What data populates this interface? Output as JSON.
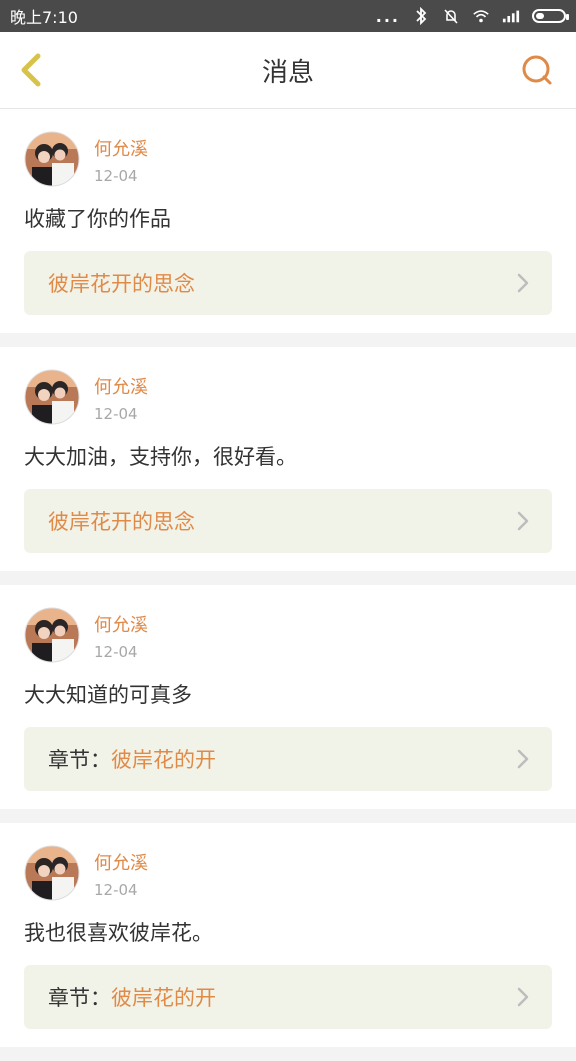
{
  "status": {
    "time": "晚上7:10",
    "dots": "...",
    "icons": [
      "bluetooth-icon",
      "mute-bell-icon",
      "wifi-icon",
      "signal-icon",
      "battery-icon"
    ]
  },
  "header": {
    "title": "消息",
    "back_icon": "chevron-left-icon",
    "search_icon": "search-icon"
  },
  "colors": {
    "accent": "#e08a48",
    "back": "#d8c34a",
    "card_link_bg": "#f2f3e8"
  },
  "messages": [
    {
      "username": "何允溪",
      "date": "12-04",
      "text": "收藏了你的作品",
      "prefix": "",
      "work": "彼岸花开的思念"
    },
    {
      "username": "何允溪",
      "date": "12-04",
      "text": "大大加油，支持你，很好看。",
      "prefix": "",
      "work": "彼岸花开的思念"
    },
    {
      "username": "何允溪",
      "date": "12-04",
      "text": "大大知道的可真多",
      "prefix": "章节：",
      "work": "彼岸花的开"
    },
    {
      "username": "何允溪",
      "date": "12-04",
      "text": "我也很喜欢彼岸花。",
      "prefix": "章节：",
      "work": "彼岸花的开"
    }
  ]
}
